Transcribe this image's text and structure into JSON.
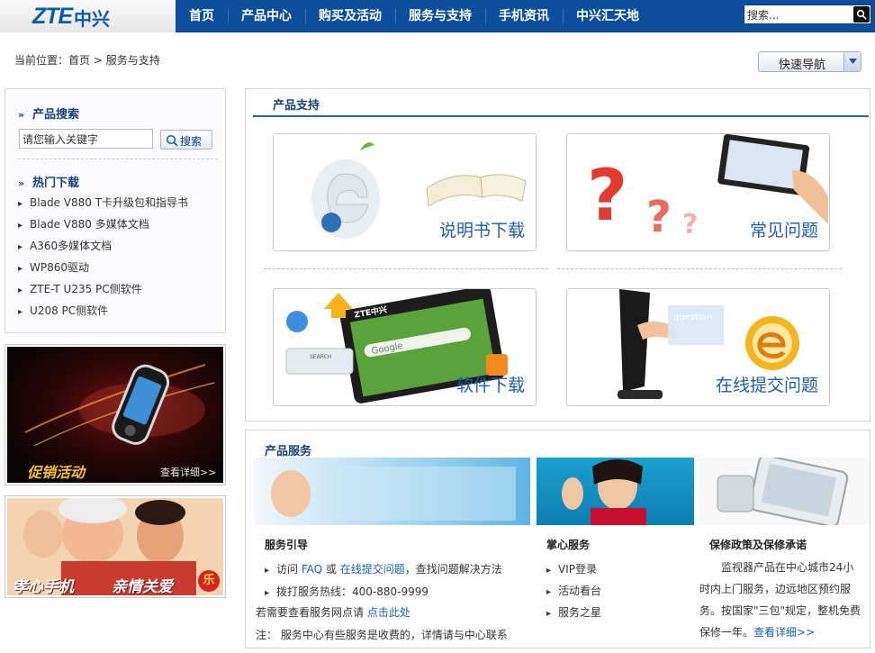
{
  "header": {
    "logo_text": "ZTE",
    "logo_cn": "中兴",
    "nav": [
      "首页",
      "产品中心",
      "购买及活动",
      "服务与支持",
      "手机资讯",
      "中兴汇天地"
    ],
    "search_placeholder": "搜索..."
  },
  "breadcrumb": {
    "prefix": "当前位置：",
    "home": "首页",
    "sep": " > ",
    "current": "服务与支持"
  },
  "quick_nav": {
    "label": "快速导航"
  },
  "sidebar": {
    "search_title": "产品搜索",
    "search_value": "请您输入关键字",
    "search_button": "搜索",
    "downloads_title": "热门下载",
    "downloads": [
      "Blade V880 T卡升级包和指导书",
      "Blade V880 多媒体文档",
      "A360多媒体文档",
      "WP860驱动",
      "ZTE-T U235 PC侧软件",
      "U208 PC侧软件"
    ],
    "promo1": {
      "title": "促销活动",
      "more": "查看详细>>"
    },
    "promo2": {
      "title_left": "孝心手机",
      "title_right": "亲情关爱",
      "seal": "乐"
    }
  },
  "support": {
    "title": "产品支持",
    "cards": [
      "说明书下载",
      "常见问题",
      "软件下载",
      "在线提交问题"
    ],
    "card_texts": {
      "question": "question",
      "search": "SEARCH",
      "google": "Google",
      "brand": "ZTE中兴"
    }
  },
  "service": {
    "title": "产品服务",
    "col1": {
      "title": "服务引导",
      "line1_a": "访问 ",
      "line1_faq": "FAQ",
      "line1_b": " 或 ",
      "line1_link": "在线提交问题",
      "line1_c": "，查找问题解决方法",
      "line2": "拨打服务热线：400-880-9999",
      "line3_a": "若需要查看服务网点请 ",
      "line3_link": "点击此处",
      "line4": "注： 服务中心有些服务是收费的，详情请与中心联系"
    },
    "col2": {
      "title": "掌心服务",
      "items": [
        "VIP登录",
        "活动看台",
        "服务之星"
      ]
    },
    "col3": {
      "title": "保修政策及保修承诺",
      "text": "监视器产品在中心城市24小时内上门服务，边远地区预约服务。按国家\"三包\"规定，整机免费保修一年。",
      "more": "查看详细>>"
    }
  },
  "colors": {
    "nav_bg": "#0c4e9b",
    "link": "#1a5fb4",
    "title": "#1a3f73"
  }
}
